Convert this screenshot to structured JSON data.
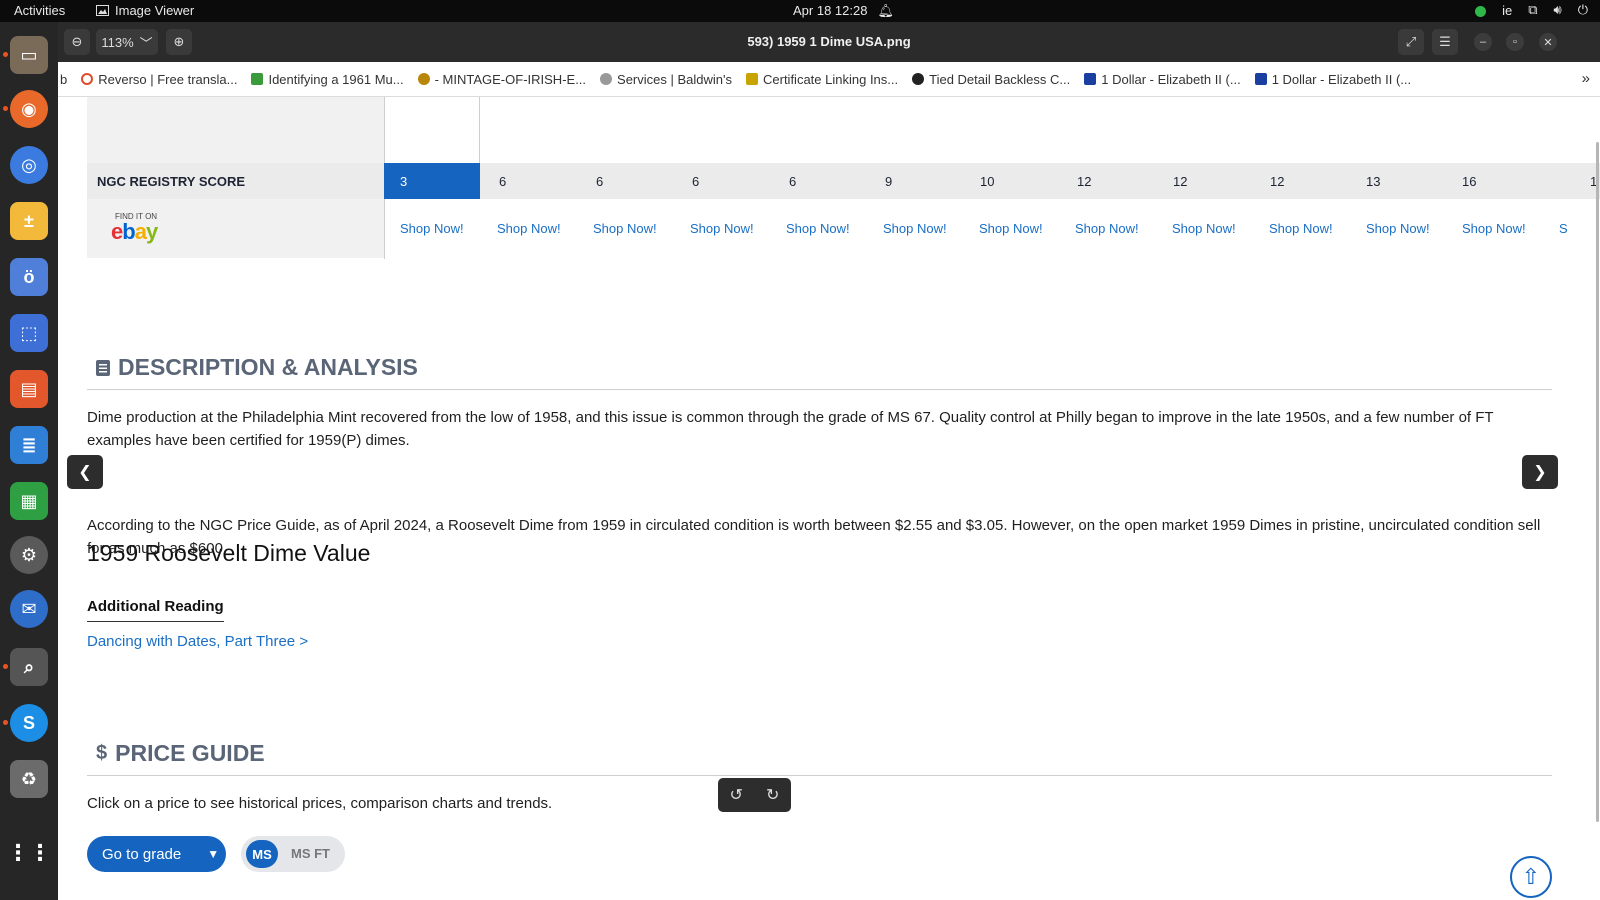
{
  "topbar": {
    "activities": "Activities",
    "app_name": "Image Viewer",
    "clock": "Apr 18  12:28",
    "keyboard": "ie"
  },
  "viewer": {
    "zoom": "113%",
    "title": "593) 1959  1 Dime USA.png"
  },
  "bookmarks": [
    {
      "label": "b",
      "color": "#888888"
    },
    {
      "label": "Reverso | Free transla...",
      "color": "#e04b2a"
    },
    {
      "label": "Identifying a 1961 Mu...",
      "color": "#3a9b3a"
    },
    {
      "label": "- MINTAGE-OF-IRISH-E...",
      "color": "#b8860b"
    },
    {
      "label": "Services | Baldwin's",
      "color": "#777777"
    },
    {
      "label": "Certificate Linking Ins...",
      "color": "#c8a400"
    },
    {
      "label": "Tied Detail Backless C...",
      "color": "#222222"
    },
    {
      "label": "1 Dollar - Elizabeth II (...",
      "color": "#1a3fa0"
    },
    {
      "label": "1 Dollar - Elizabeth II (...",
      "color": "#1a3fa0"
    }
  ],
  "registry": {
    "label": "NGC REGISTRY SCORE",
    "scores": [
      "3",
      "6",
      "6",
      "6",
      "6",
      "9",
      "10",
      "12",
      "12",
      "12",
      "13",
      "16",
      "1"
    ]
  },
  "ebay": {
    "find_it_on": "FIND IT ON",
    "logo_letters": [
      "e",
      "b",
      "a",
      "y"
    ],
    "shop_label": "Shop Now!",
    "shop_last": "S"
  },
  "description": {
    "heading": "DESCRIPTION & ANALYSIS",
    "body": "Dime production at the Philadelphia Mint recovered from the low of 1958, and this issue is common through the grade of MS 67. Quality control at Philly began to improve in the late 1950s, and a few number of FT examples have been certified for 1959(P) dimes."
  },
  "value": {
    "heading": "1959 Roosevelt Dime Value",
    "body": "According to the NGC Price Guide, as of April 2024, a Roosevelt Dime from 1959 in circulated condition is worth between $2.55 and $3.05. However, on the open market 1959 Dimes in pristine, uncirculated condition sell for as much as $600."
  },
  "reading": {
    "heading": "Additional Reading",
    "link": "Dancing with Dates, Part Three >"
  },
  "price_guide": {
    "icon": "$",
    "heading": "PRICE GUIDE",
    "body": "Click on a price to see historical prices, comparison charts and trends.",
    "go_to_grade": "Go to grade",
    "toggle_ms": "MS",
    "toggle_msft": "MS FT"
  },
  "colors": {
    "accent": "#1565c0",
    "link": "#1a6fc4",
    "heading_gray": "#5a6577"
  }
}
